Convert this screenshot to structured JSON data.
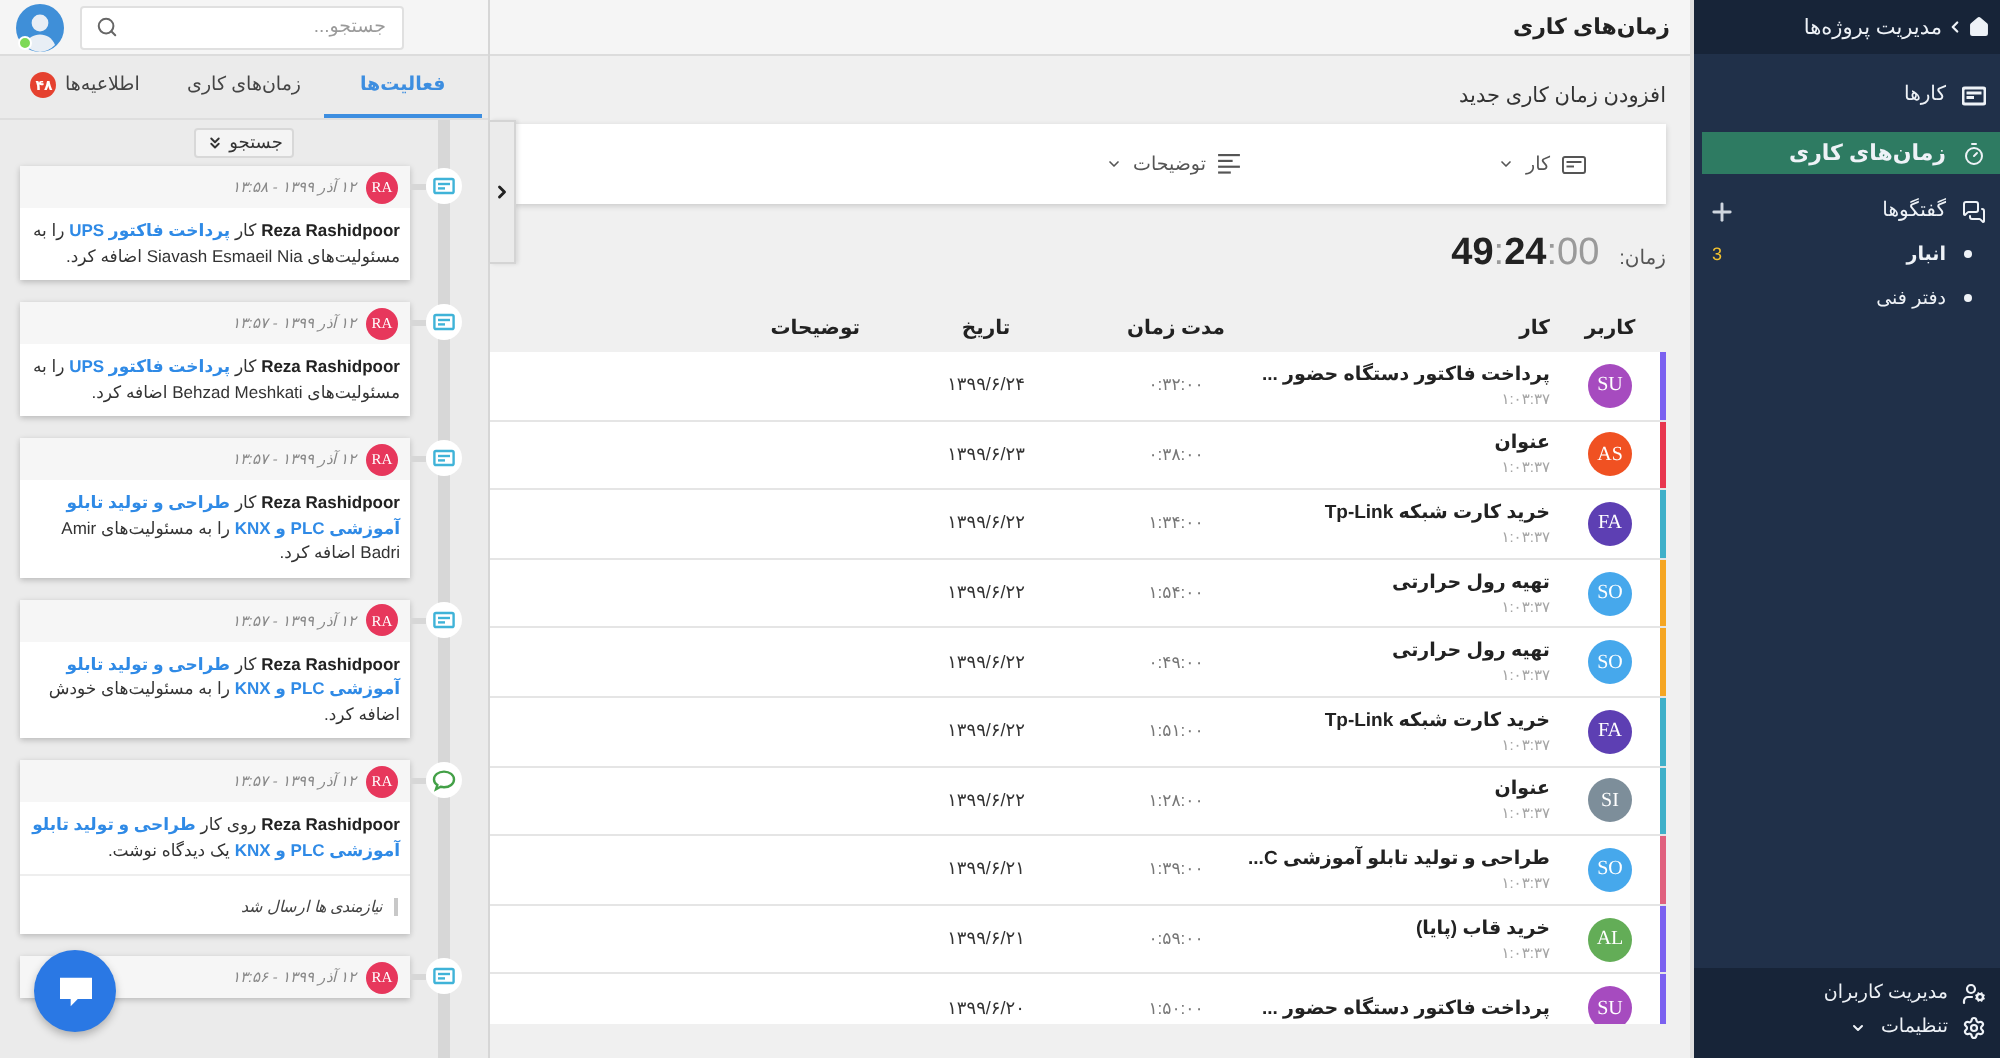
{
  "sidebar": {
    "title": "مدیریت پروژه‌ها",
    "nav": [
      {
        "label": "کارها",
        "selected": false,
        "addable": false
      },
      {
        "label": "زمان‌های کاری",
        "selected": true,
        "addable": false
      },
      {
        "label": "گفتگوها",
        "selected": false,
        "addable": true,
        "children": [
          {
            "label": "انبار",
            "unread": true,
            "badge": "3"
          },
          {
            "label": "دفتر فنی",
            "unread": false
          }
        ]
      }
    ],
    "footer": [
      {
        "label": "مدیریت کاربران",
        "expandable": false
      },
      {
        "label": "تنظیمات",
        "expandable": true
      }
    ]
  },
  "main": {
    "title": "زمان‌های کاری",
    "form": {
      "heading": "افزودن زمان کاری جدید",
      "fields": [
        {
          "label": "کار"
        },
        {
          "label": "توضیحات"
        }
      ]
    },
    "timer": {
      "label": "زمان:",
      "value": "**49**:**24**:00"
    },
    "table": {
      "columns": [
        "کاربر",
        "کار",
        "مدت زمان",
        "تاریخ",
        "توضیحات"
      ],
      "rows": [
        {
          "color": "#7b61f0",
          "user": {
            "initials": "SU",
            "color": "#a64bbf"
          },
          "task": "پرداخت فاکتور دستگاه حضور ...",
          "elapsed": "۱:۰۳:۳۷",
          "duration": "۰:۳۲:۰۰",
          "date": "۱۳۹۹/۶/۲۴"
        },
        {
          "color": "#e8364f",
          "user": {
            "initials": "AS",
            "color": "#f05122"
          },
          "task": "عنوان",
          "elapsed": "۱:۰۳:۳۷",
          "duration": "۰:۳۸:۰۰",
          "date": "۱۳۹۹/۶/۲۳"
        },
        {
          "color": "#3fb0c9",
          "user": {
            "initials": "FA",
            "color": "#5d3fb3"
          },
          "task": "خرید کارت شبکه Tp-Link",
          "elapsed": "۱:۰۳:۳۷",
          "duration": "۱:۳۴:۰۰",
          "date": "۱۳۹۹/۶/۲۲"
        },
        {
          "color": "#f5a623",
          "user": {
            "initials": "SO",
            "color": "#46a8ec"
          },
          "task": "تهیه رول حرارتی",
          "elapsed": "۱:۰۳:۳۷",
          "duration": "۱:۵۴:۰۰",
          "date": "۱۳۹۹/۶/۲۲"
        },
        {
          "color": "#f5a623",
          "user": {
            "initials": "SO",
            "color": "#46a8ec"
          },
          "task": "تهیه رول حرارتی",
          "elapsed": "۱:۰۳:۳۷",
          "duration": "۰:۴۹:۰۰",
          "date": "۱۳۹۹/۶/۲۲"
        },
        {
          "color": "#3fb0c9",
          "user": {
            "initials": "FA",
            "color": "#5d3fb3"
          },
          "task": "خرید کارت شبکه Tp-Link",
          "elapsed": "۱:۰۳:۳۷",
          "duration": "۱:۵۱:۰۰",
          "date": "۱۳۹۹/۶/۲۲"
        },
        {
          "color": "#3fb0c9",
          "user": {
            "initials": "SI",
            "color": "#7d8e9a"
          },
          "task": "عنوان",
          "elapsed": "۱:۰۳:۳۷",
          "duration": "۱:۲۸:۰۰",
          "date": "۱۳۹۹/۶/۲۲"
        },
        {
          "color": "#e0607e",
          "user": {
            "initials": "SO",
            "color": "#46a8ec"
          },
          "task": "طراحی و تولید تابلو آموزشی C...",
          "elapsed": "۱:۰۳:۳۷",
          "duration": "۱:۳۹:۰۰",
          "date": "۱۳۹۹/۶/۲۱"
        },
        {
          "color": "#7b61f0",
          "user": {
            "initials": "AL",
            "color": "#63ad57"
          },
          "task": "خرید قاب (پایا)",
          "elapsed": "۱:۰۳:۳۷",
          "duration": "۰:۵۹:۰۰",
          "date": "۱۳۹۹/۶/۲۱"
        },
        {
          "color": "#7b61f0",
          "user": {
            "initials": "SU",
            "color": "#a64bbf"
          },
          "task": "پرداخت فاکتور دستگاه حضور ...",
          "duration": "۱:۵۰:۰۰",
          "date": "۱۳۹۹/۶/۲۰"
        }
      ]
    }
  },
  "activity_panel": {
    "user": {
      "online": true
    },
    "search": {
      "placeholder": "جستجو..."
    },
    "tabs": [
      {
        "label": "فعالیت‌ها",
        "selected": true
      },
      {
        "label": "زمان‌های کاری",
        "selected": false
      },
      {
        "label": "اطلاعیه‌ها",
        "selected": false,
        "badge": "۴۸"
      }
    ],
    "filter_button": "جستجو",
    "activities": [
      {
        "kind": "assign",
        "initials": "RA",
        "time": "۱۲ آذر ۱۳۹۹ - ۱۳:۵۸",
        "parts": [
          {
            "kind": "user",
            "text": "Reza Rashidpoor"
          },
          {
            "kind": "text",
            "text": "کار"
          },
          {
            "kind": "link",
            "text": "پرداخت فاکتور UPS"
          },
          {
            "kind": "text",
            "text": "را به مسئولیت‌های Siavash Esmaeil Nia اضافه کرد."
          }
        ]
      },
      {
        "kind": "assign",
        "initials": "RA",
        "time": "۱۲ آذر ۱۳۹۹ - ۱۳:۵۷",
        "parts": [
          {
            "kind": "user",
            "text": "Reza Rashidpoor"
          },
          {
            "kind": "text",
            "text": "کار"
          },
          {
            "kind": "link",
            "text": "پرداخت فاکتور UPS"
          },
          {
            "kind": "text",
            "text": "را به مسئولیت‌های Behzad Meshkati اضافه کرد."
          }
        ]
      },
      {
        "kind": "assign",
        "initials": "RA",
        "time": "۱۲ آذر ۱۳۹۹ - ۱۳:۵۷",
        "parts": [
          {
            "kind": "user",
            "text": "Reza Rashidpoor"
          },
          {
            "kind": "text",
            "text": "کار"
          },
          {
            "kind": "link",
            "text": "طراحی و تولید تابلو"
          },
          {
            "kind": "link",
            "text": "آموزشی PLC و KNX"
          },
          {
            "kind": "text",
            "text": "را به مسئولیت‌های Amir Badri اضافه کرد."
          }
        ]
      },
      {
        "kind": "assign",
        "initials": "RA",
        "time": "۱۲ آذر ۱۳۹۹ - ۱۳:۵۷",
        "parts": [
          {
            "kind": "user",
            "text": "Reza Rashidpoor"
          },
          {
            "kind": "text",
            "text": "کار"
          },
          {
            "kind": "link",
            "text": "طراحی و تولید تابلو"
          },
          {
            "kind": "link",
            "text": "آموزشی PLC و KNX"
          },
          {
            "kind": "text",
            "text": "را به مسئولیت‌های خودش اضافه کرد."
          }
        ]
      },
      {
        "kind": "comment",
        "initials": "RA",
        "time": "۱۲ آذر ۱۳۹۹ - ۱۳:۵۷",
        "parts": [
          {
            "kind": "user",
            "text": "Reza Rashidpoor"
          },
          {
            "kind": "text",
            "text": "روی کار"
          },
          {
            "kind": "link",
            "text": "طراحی و تولید تابلو"
          },
          {
            "kind": "link",
            "text": "آموزشی PLC و KNX"
          },
          {
            "kind": "text",
            "text": "یک دیدگاه نوشت."
          }
        ],
        "quote": "نیازمندی ها ارسال شد"
      },
      {
        "kind": "assign",
        "initials": "RA",
        "time": "۱۲ آذر ۱۳۹۹ - ۱۳:۵۶"
      }
    ]
  }
}
